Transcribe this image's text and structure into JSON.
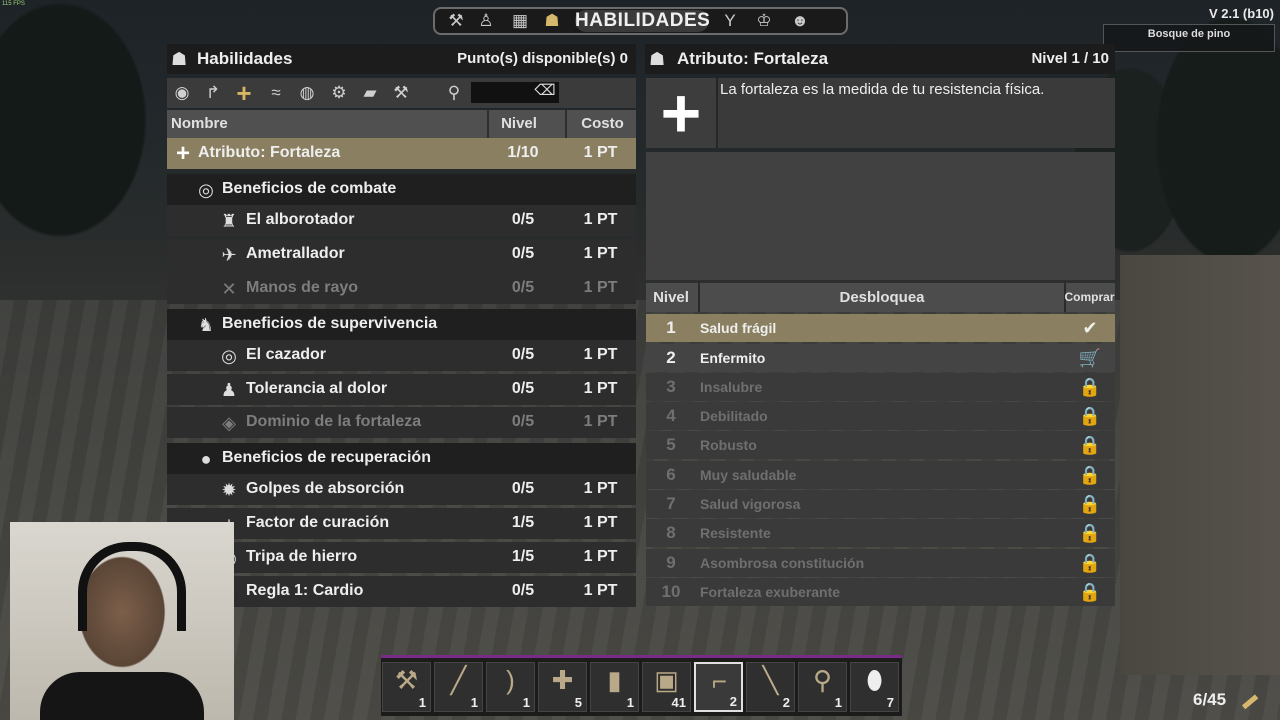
{
  "hud": {
    "fps": "115 FPS",
    "version": "V 2.1 (b10)",
    "biome": "Bosque de pino",
    "ammo": "6/45"
  },
  "topbar": {
    "title": "HABILIDADES"
  },
  "left_panel": {
    "title": "Habilidades",
    "points": "Punto(s) disponible(s) 0",
    "columns": {
      "name": "Nombre",
      "level": "Nivel",
      "cost": "Costo"
    },
    "rows": [
      {
        "name": "Atributo: Fortaleza",
        "level": "1/10",
        "cost": "1 PT"
      },
      {
        "name": "Beneficios de combate"
      },
      {
        "name": "El alborotador",
        "level": "0/5",
        "cost": "1 PT"
      },
      {
        "name": "Ametrallador",
        "level": "0/5",
        "cost": "1 PT"
      },
      {
        "name": "Manos de rayo",
        "level": "0/5",
        "cost": "1 PT"
      },
      {
        "name": "Beneficios de supervivencia"
      },
      {
        "name": "El cazador",
        "level": "0/5",
        "cost": "1 PT"
      },
      {
        "name": "Tolerancia al dolor",
        "level": "0/5",
        "cost": "1 PT"
      },
      {
        "name": "Dominio de la fortaleza",
        "level": "0/5",
        "cost": "1 PT"
      },
      {
        "name": "Beneficios de recuperación"
      },
      {
        "name": "Golpes de absorción",
        "level": "0/5",
        "cost": "1 PT"
      },
      {
        "name": "Factor de curación",
        "level": "1/5",
        "cost": "1 PT"
      },
      {
        "name": "Tripa de hierro",
        "level": "1/5",
        "cost": "1 PT"
      },
      {
        "name": "Regla 1: Cardio",
        "level": "0/5",
        "cost": "1 PT"
      }
    ]
  },
  "right_panel": {
    "title": "Atributo: Fortaleza",
    "level": "Nivel 1 / 10",
    "description": "La fortaleza es la medida de tu resistencia física.",
    "columns": {
      "level": "Nivel",
      "unlocks": "Desbloquea",
      "buy": "Comprar"
    },
    "levels": [
      {
        "n": "1",
        "name": "Salud frágil"
      },
      {
        "n": "2",
        "name": "Enfermito"
      },
      {
        "n": "3",
        "name": "Insalubre"
      },
      {
        "n": "4",
        "name": "Debilitado"
      },
      {
        "n": "5",
        "name": "Robusto"
      },
      {
        "n": "6",
        "name": "Muy saludable"
      },
      {
        "n": "7",
        "name": "Salud vigorosa"
      },
      {
        "n": "8",
        "name": "Resistente"
      },
      {
        "n": "9",
        "name": "Asombrosa constitución"
      },
      {
        "n": "10",
        "name": "Fortaleza exuberante"
      }
    ]
  },
  "hotbar": [
    {
      "icon": "stone-axe-icon",
      "count": "1"
    },
    {
      "icon": "club-icon",
      "count": "1"
    },
    {
      "icon": "bow-icon",
      "count": "1"
    },
    {
      "icon": "bandage-icon",
      "count": "5"
    },
    {
      "icon": "canned-food-icon",
      "count": "1"
    },
    {
      "icon": "storage-box-icon",
      "count": "41"
    },
    {
      "icon": "pistol-icon",
      "count": "2"
    },
    {
      "icon": "torch-icon",
      "count": "2"
    },
    {
      "icon": "wrench-icon",
      "count": "1"
    },
    {
      "icon": "egg-icon",
      "count": "7"
    }
  ]
}
